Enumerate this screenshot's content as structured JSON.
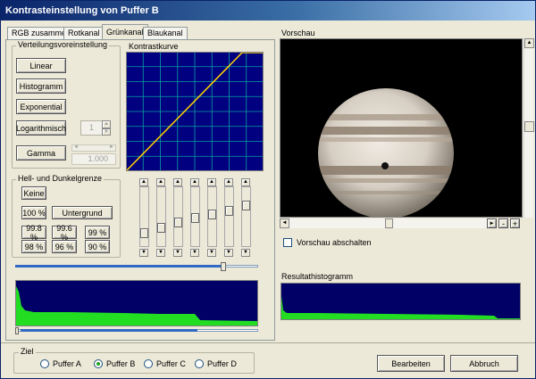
{
  "window": {
    "title": "Kontrasteinstellung von Puffer B"
  },
  "tabs": [
    {
      "label": "RGB zusammen",
      "active": false
    },
    {
      "label": "Rotkanal",
      "active": false
    },
    {
      "label": "Grünkanal",
      "active": true
    },
    {
      "label": "Blaukanal",
      "active": false
    }
  ],
  "distribution": {
    "group_label": "Verteilungsvoreinstellung",
    "linear": "Linear",
    "histogram": "Histogramm",
    "exponential": "Exponential",
    "logarithmic": "Logarithmisch",
    "log_value": "1",
    "gamma": "Gamma",
    "gamma_value": "1.000"
  },
  "curve": {
    "label": "Kontrastkurve",
    "background_color": "#000080",
    "grid_color": "#0aa0a0",
    "curve_color": "#ffd200"
  },
  "limits": {
    "group_label": "Hell- und Dunkelgrenze",
    "none": "Keine",
    "p100": "100 %",
    "background": "Untergrund",
    "p99_8": "99.8 %",
    "p99_6": "99.6 %",
    "p99": "99 %",
    "p98": "98 %",
    "p96": "96 %",
    "p90": "90 %"
  },
  "level_sliders": [
    0.82,
    0.72,
    0.62,
    0.52,
    0.45,
    0.38,
    0.28
  ],
  "histogram_fill_color": "#22dd22",
  "histogram_bg_color": "#000066",
  "preview": {
    "label": "Vorschau",
    "disable_label": "Vorschau abschalten",
    "disable_checked": false,
    "hscroll_position": 0.45,
    "vscroll_position": 0.45
  },
  "result": {
    "label": "Resultathistogramm"
  },
  "target": {
    "group_label": "Ziel",
    "options": [
      {
        "label": "Puffer A",
        "selected": false
      },
      {
        "label": "Puffer B",
        "selected": true
      },
      {
        "label": "Puffer C",
        "selected": false
      },
      {
        "label": "Puffer D",
        "selected": false
      }
    ]
  },
  "footer": {
    "edit": "Bearbeiten",
    "cancel": "Abbruch"
  },
  "zoom_buttons": {
    "minus": "-",
    "plus": "+"
  }
}
